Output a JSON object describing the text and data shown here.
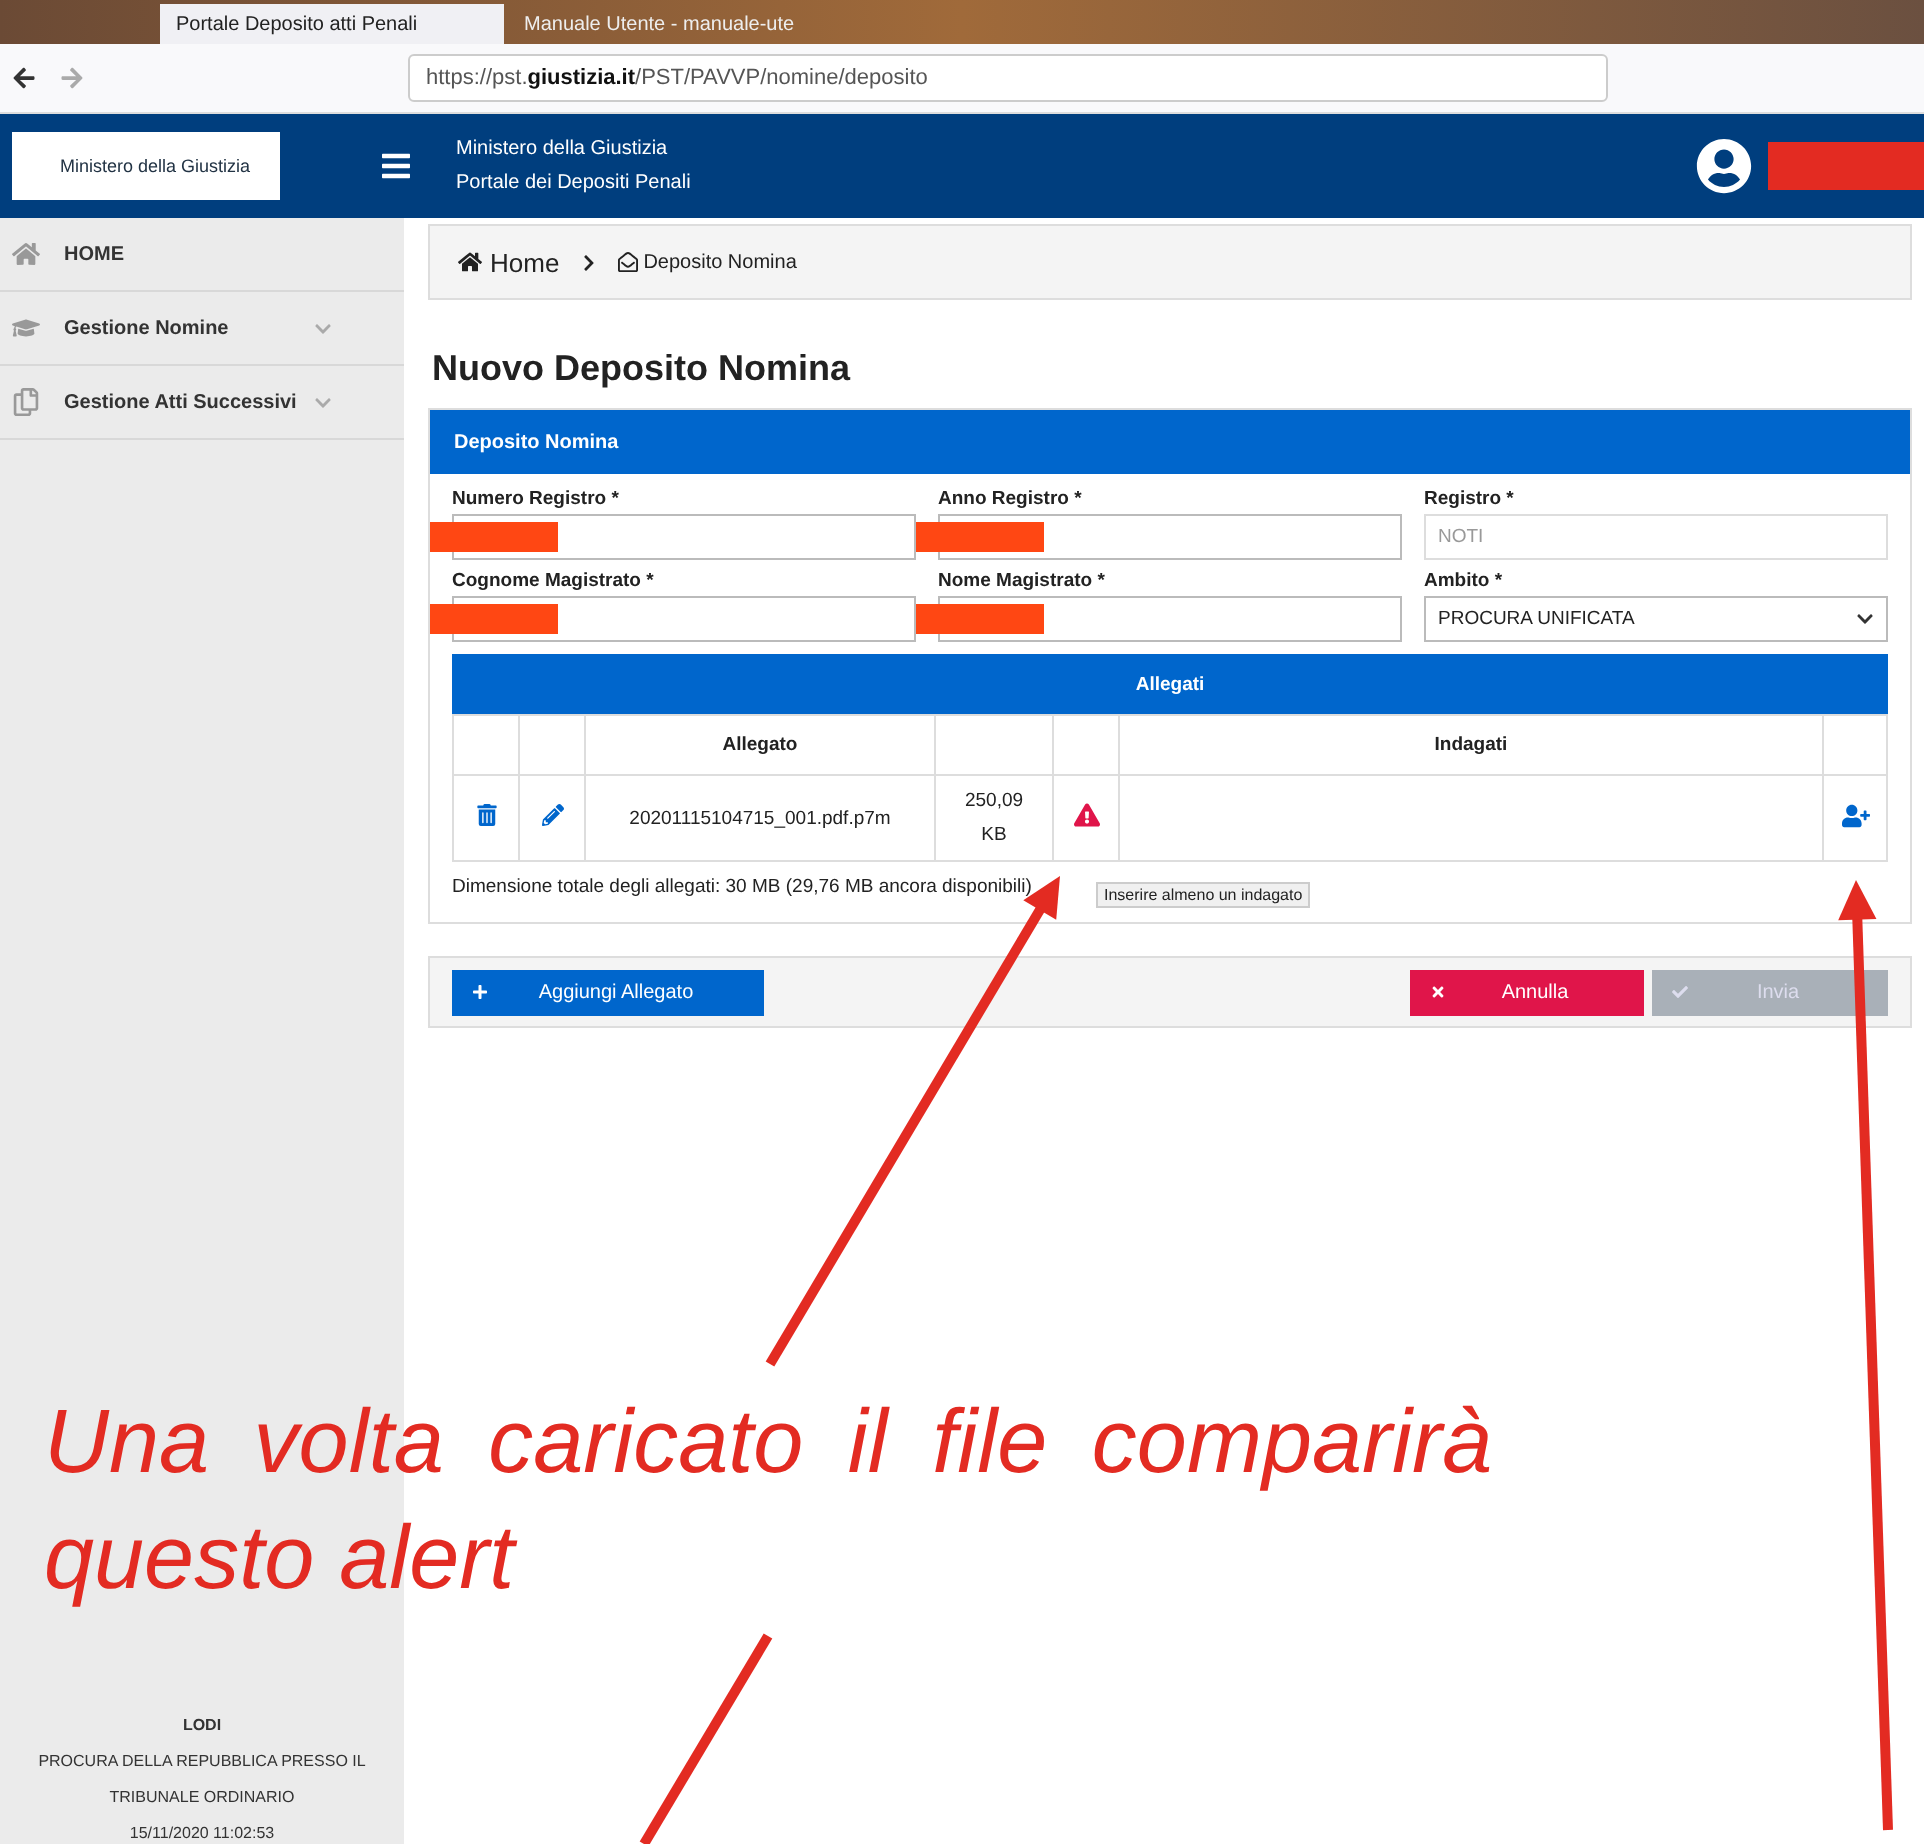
{
  "browser": {
    "tabs": [
      {
        "label": "Portale Deposito atti Penali",
        "selected": true
      },
      {
        "label": "Manuale Utente - manuale-ute",
        "selected": false
      }
    ],
    "url": "https://pst.**giustizia.it**/PST/PAVVP/nomine/deposito"
  },
  "header": {
    "logo": "Ministero della Giustizia",
    "title": "Ministero della Giustizia",
    "subtitle": "Portale dei Depositi Penali",
    "user_redacted": true
  },
  "sidebar": {
    "items": [
      {
        "label": "HOME",
        "kind": "home",
        "expandable": false
      },
      {
        "label": "Gestione Nomine",
        "kind": "appointments",
        "expandable": true
      },
      {
        "label": "Gestione Atti Successivi",
        "kind": "documents",
        "expandable": true
      }
    ],
    "footer": {
      "city": "LODI",
      "office": "PROCURA DELLA REPUBBLICA PRESSO IL TRIBUNALE ORDINARIO",
      "datetime": "15/11/2020 11:02:53"
    }
  },
  "breadcrumb": [
    "Home",
    "Deposito Nomina"
  ],
  "page_title": "Nuovo Deposito Nomina",
  "form": {
    "title": "Deposito Nomina",
    "fields": [
      {
        "label": "Numero Registro *",
        "kind": "text",
        "redacted": true,
        "disabled": false
      },
      {
        "label": "Anno Registro *",
        "kind": "text",
        "redacted": true,
        "disabled": false
      },
      {
        "label": "Registro *",
        "kind": "text",
        "value": "NOTI",
        "disabled": true
      },
      {
        "label": "Cognome Magistrato *",
        "kind": "text",
        "redacted": true,
        "disabled": false
      },
      {
        "label": "Nome Magistrato *",
        "kind": "text",
        "redacted": true,
        "disabled": false
      },
      {
        "label": "Ambito *",
        "kind": "select",
        "value": "PROCURA UNIFICATA",
        "disabled": false
      }
    ]
  },
  "attachments": {
    "title": "Allegati",
    "columns": {
      "file": "Allegato",
      "suspects": "Indagati"
    },
    "rows": [
      {
        "file": "20201115104715_001.pdf.p7m",
        "size": "250,09 KB",
        "alert": true
      }
    ],
    "tooltip": "Inserire almeno un indagato",
    "total": "Dimensione totale degli allegati: 30 MB (29,76 MB ancora disponibili)"
  },
  "actions": {
    "add": "Aggiungi Allegato",
    "cancel": "Annulla",
    "submit": {
      "label": "Invia",
      "disabled": true
    }
  },
  "annotation": "Una volta caricato il file comparirà questo alert"
}
